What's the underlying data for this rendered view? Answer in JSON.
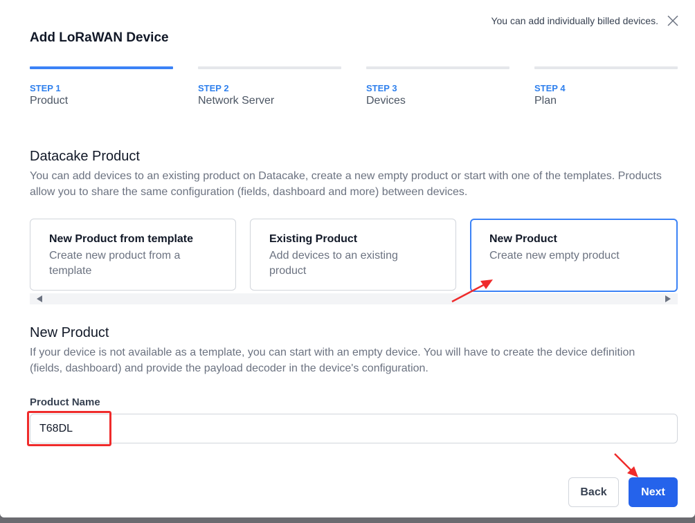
{
  "header": {
    "notice": "You can add individually billed devices.",
    "title": "Add LoRaWAN Device"
  },
  "steps": [
    {
      "number": "STEP 1",
      "name": "Product",
      "active": true
    },
    {
      "number": "STEP 2",
      "name": "Network Server",
      "active": false
    },
    {
      "number": "STEP 3",
      "name": "Devices",
      "active": false
    },
    {
      "number": "STEP 4",
      "name": "Plan",
      "active": false
    }
  ],
  "product_section": {
    "title": "Datacake Product",
    "description": "You can add devices to an existing product on Datacake, create a new empty product or start with one of the templates. Products allow you to share the same configuration (fields, dashboard and more) between devices.",
    "options": [
      {
        "title": "New Product from template",
        "description": "Create new product from a template",
        "selected": false
      },
      {
        "title": "Existing Product",
        "description": "Add devices to an existing product",
        "selected": false
      },
      {
        "title": "New Product",
        "description": "Create new empty product",
        "selected": true
      }
    ]
  },
  "new_product_section": {
    "title": "New Product",
    "description": "If your device is not available as a template, you can start with an empty device. You will have to create the device definition (fields, dashboard) and provide the payload decoder in the device's configuration.",
    "field_label": "Product Name",
    "field_value": "T68DL"
  },
  "footer": {
    "back_label": "Back",
    "next_label": "Next"
  },
  "colors": {
    "accent": "#3b82f6",
    "primary_button": "#2563eb",
    "annotation": "#ef2b2b"
  },
  "icons": [
    "close-icon",
    "chevron-left-icon",
    "chevron-right-icon",
    "arrow-annotation-icon"
  ]
}
